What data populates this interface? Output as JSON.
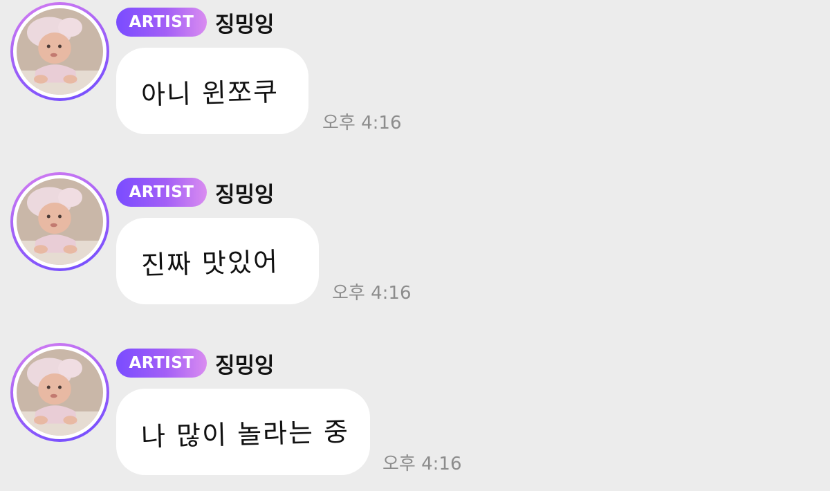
{
  "messages": [
    {
      "badge": "ARTIST",
      "sender": "징밍잉",
      "text": "아니 윈쪼쿠",
      "time": "오후 4:16"
    },
    {
      "badge": "ARTIST",
      "sender": "징밍잉",
      "text": "진짜 맛있어",
      "time": "오후 4:16"
    },
    {
      "badge": "ARTIST",
      "sender": "징밍잉",
      "text": "나 많이 놀라는 중",
      "time": "오후 4:16"
    }
  ],
  "colors": {
    "background": "#ececec",
    "bubble": "#ffffff",
    "badge_gradient_start": "#7a4cff",
    "badge_gradient_end": "#d98cf0",
    "timestamp": "#8c8c8c"
  }
}
